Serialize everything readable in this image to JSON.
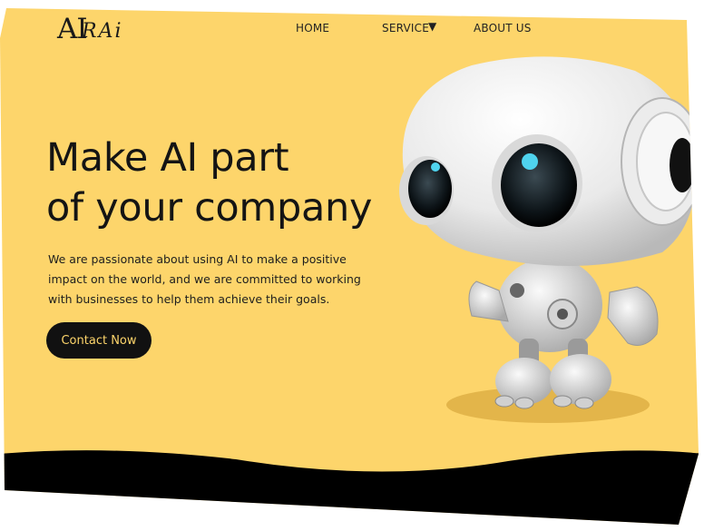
{
  "brand": {
    "logo_text": "AI",
    "logo_script": "RAi"
  },
  "nav": {
    "home": "HOME",
    "service": "SERVICE",
    "service_caret": "▼",
    "about": "ABOUT US"
  },
  "hero": {
    "headline_line1": "Make AI part",
    "headline_line2": "of your company",
    "sub_line1": "We are passionate about using AI to make a positive",
    "sub_line2": "impact on the world, and we are committed to working",
    "sub_line3": "with businesses to help them achieve their goals.",
    "cta_label": "Contact Now"
  },
  "colors": {
    "background": "#fdd56b",
    "dark": "#111111",
    "accent": "#4fd3ee"
  },
  "icons": {
    "robot": "robot-illustration",
    "caret": "chevron-down-icon"
  }
}
